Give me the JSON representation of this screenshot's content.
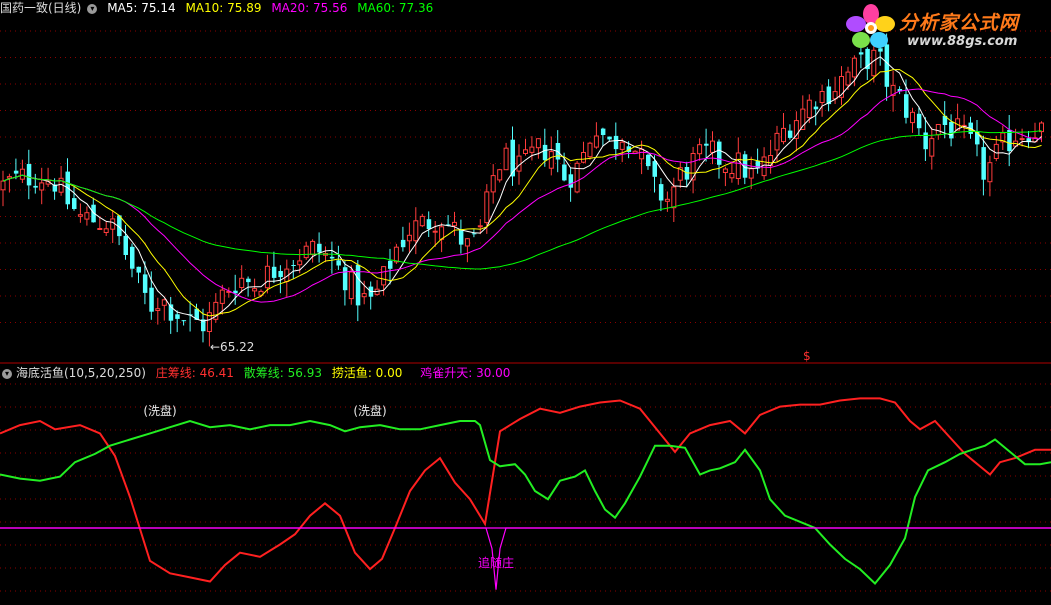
{
  "main_header": {
    "title": "国药一致(日线)",
    "ma5": "MA5: 75.14",
    "ma10": "MA10: 75.89",
    "ma20": "MA20: 75.56",
    "ma60": "MA60: 77.36"
  },
  "sub_header": {
    "title": "海底活鱼(10,5,20,250)",
    "zhuang": "庄筹线: 46.41",
    "san": "散筹线: 56.93",
    "lao": "捞活鱼: 0.00",
    "que": "鸡雀升天: 30.00"
  },
  "logo": {
    "title": "分析家公式网",
    "url": "www.88gs.com"
  },
  "colors": {
    "up": "#ff3c3c",
    "down": "#54ffff",
    "ma5": "#ffffff",
    "ma10": "#ffff00",
    "ma20": "#ff00ff",
    "ma60": "#00ff00",
    "zhuang": "#ff2020",
    "san": "#22ee22",
    "que": "#ff00ff",
    "grid": "#8b0000"
  },
  "chart_data": [
    {
      "type": "candlestick",
      "title": "国药一致(日线)",
      "low_label": "65.22",
      "marker": "$",
      "ylim": [
        63,
        86
      ],
      "ma_series": [
        "MA5",
        "MA10",
        "MA20",
        "MA60"
      ],
      "ma_values": {
        "MA5": 75.14,
        "MA10": 75.89,
        "MA20": 75.56,
        "MA60": 77.36
      },
      "close_profile": [
        [
          0,
          74.6
        ],
        [
          10,
          75.0
        ],
        [
          25,
          75.3
        ],
        [
          40,
          75.4
        ],
        [
          55,
          75.0
        ],
        [
          65,
          73.8
        ],
        [
          80,
          72.6
        ],
        [
          95,
          72.4
        ],
        [
          110,
          72.2
        ],
        [
          120,
          71.0
        ],
        [
          130,
          69.5
        ],
        [
          140,
          67.8
        ],
        [
          150,
          66.6
        ],
        [
          160,
          67.2
        ],
        [
          170,
          66.5
        ],
        [
          180,
          66.0
        ],
        [
          190,
          65.6
        ],
        [
          205,
          65.4
        ],
        [
          215,
          66.4
        ],
        [
          225,
          67.7
        ],
        [
          240,
          68.5
        ],
        [
          255,
          68.1
        ],
        [
          270,
          68.9
        ],
        [
          285,
          69.6
        ],
        [
          300,
          70.1
        ],
        [
          315,
          70.5
        ],
        [
          330,
          69.8
        ],
        [
          345,
          68.6
        ],
        [
          360,
          67.1
        ],
        [
          372,
          66.9
        ],
        [
          382,
          68.2
        ],
        [
          395,
          70.4
        ],
        [
          410,
          71.8
        ],
        [
          425,
          72.2
        ],
        [
          440,
          72.7
        ],
        [
          455,
          71.6
        ],
        [
          470,
          70.4
        ],
        [
          482,
          71.9
        ],
        [
          495,
          75.9
        ],
        [
          505,
          76.6
        ],
        [
          520,
          75.7
        ],
        [
          535,
          77.0
        ],
        [
          550,
          77.3
        ],
        [
          565,
          75.2
        ],
        [
          580,
          76.1
        ],
        [
          595,
          79.0
        ],
        [
          610,
          77.4
        ],
        [
          625,
          78.4
        ],
        [
          640,
          76.6
        ],
        [
          655,
          74.4
        ],
        [
          668,
          73.8
        ],
        [
          680,
          75.4
        ],
        [
          695,
          76.4
        ],
        [
          710,
          76.9
        ],
        [
          725,
          76.3
        ],
        [
          740,
          76.1
        ],
        [
          755,
          75.2
        ],
        [
          770,
          76.8
        ],
        [
          785,
          78.6
        ],
        [
          800,
          79.6
        ],
        [
          815,
          80.7
        ],
        [
          830,
          81.1
        ],
        [
          845,
          82.1
        ],
        [
          860,
          82.9
        ],
        [
          870,
          83.4
        ],
        [
          880,
          83.0
        ],
        [
          890,
          81.2
        ],
        [
          900,
          80.5
        ],
        [
          912,
          79.3
        ],
        [
          925,
          77.6
        ],
        [
          940,
          79.0
        ],
        [
          955,
          78.4
        ],
        [
          970,
          77.5
        ],
        [
          985,
          75.5
        ],
        [
          1000,
          77.1
        ],
        [
          1015,
          78.2
        ],
        [
          1030,
          78.5
        ],
        [
          1051,
          78.6
        ]
      ]
    },
    {
      "type": "line",
      "title": "海底活鱼(10,5,20,250)",
      "ylim": [
        -5,
        100
      ],
      "series": [
        {
          "name": "庄筹线",
          "values": [
            [
              0,
              76
            ],
            [
              20,
              80
            ],
            [
              40,
              82
            ],
            [
              55,
              78
            ],
            [
              80,
              80
            ],
            [
              100,
              76
            ],
            [
              115,
              65
            ],
            [
              130,
              45
            ],
            [
              150,
              14
            ],
            [
              170,
              8
            ],
            [
              190,
              6
            ],
            [
              210,
              4
            ],
            [
              225,
              12
            ],
            [
              240,
              18
            ],
            [
              260,
              16
            ],
            [
              280,
              22
            ],
            [
              295,
              27
            ],
            [
              310,
              36
            ],
            [
              325,
              42
            ],
            [
              340,
              36
            ],
            [
              355,
              18
            ],
            [
              370,
              10
            ],
            [
              382,
              15
            ],
            [
              395,
              30
            ],
            [
              410,
              48
            ],
            [
              425,
              58
            ],
            [
              440,
              64
            ],
            [
              455,
              52
            ],
            [
              470,
              44
            ],
            [
              485,
              32
            ],
            [
              500,
              77
            ],
            [
              520,
              83
            ],
            [
              540,
              88
            ],
            [
              560,
              86
            ],
            [
              580,
              89
            ],
            [
              600,
              91
            ],
            [
              620,
              92
            ],
            [
              640,
              88
            ],
            [
              660,
              76
            ],
            [
              675,
              67
            ],
            [
              690,
              76
            ],
            [
              710,
              80
            ],
            [
              730,
              82
            ],
            [
              745,
              76
            ],
            [
              760,
              85
            ],
            [
              780,
              89
            ],
            [
              800,
              90
            ],
            [
              820,
              90
            ],
            [
              840,
              92
            ],
            [
              860,
              93
            ],
            [
              880,
              93
            ],
            [
              895,
              91
            ],
            [
              910,
              82
            ],
            [
              920,
              78
            ],
            [
              935,
              82
            ],
            [
              950,
              74
            ],
            [
              965,
              66
            ],
            [
              975,
              62
            ],
            [
              990,
              56
            ],
            [
              1000,
              62
            ],
            [
              1015,
              64
            ],
            [
              1035,
              68
            ],
            [
              1051,
              68
            ]
          ]
        },
        {
          "name": "散筹线",
          "values": [
            [
              0,
              56
            ],
            [
              20,
              54
            ],
            [
              40,
              53
            ],
            [
              60,
              55
            ],
            [
              75,
              62
            ],
            [
              95,
              66
            ],
            [
              110,
              70
            ],
            [
              130,
              73
            ],
            [
              150,
              76
            ],
            [
              170,
              79
            ],
            [
              190,
              82
            ],
            [
              210,
              79
            ],
            [
              230,
              80
            ],
            [
              250,
              78
            ],
            [
              270,
              80
            ],
            [
              290,
              80
            ],
            [
              310,
              82
            ],
            [
              330,
              80
            ],
            [
              345,
              77
            ],
            [
              360,
              79
            ],
            [
              380,
              80
            ],
            [
              400,
              78
            ],
            [
              420,
              78
            ],
            [
              440,
              80
            ],
            [
              460,
              82
            ],
            [
              475,
              82
            ],
            [
              480,
              80
            ],
            [
              490,
              63
            ],
            [
              500,
              60
            ],
            [
              515,
              61
            ],
            [
              525,
              56
            ],
            [
              535,
              48
            ],
            [
              548,
              44
            ],
            [
              560,
              53
            ],
            [
              575,
              55
            ],
            [
              585,
              58
            ],
            [
              595,
              48
            ],
            [
              605,
              39
            ],
            [
              615,
              35
            ],
            [
              625,
              42
            ],
            [
              640,
              55
            ],
            [
              655,
              70
            ],
            [
              670,
              70
            ],
            [
              685,
              69
            ],
            [
              700,
              56
            ],
            [
              710,
              58
            ],
            [
              720,
              59
            ],
            [
              735,
              62
            ],
            [
              745,
              68
            ],
            [
              760,
              58
            ],
            [
              770,
              44
            ],
            [
              785,
              36
            ],
            [
              800,
              33
            ],
            [
              815,
              30
            ],
            [
              830,
              22
            ],
            [
              845,
              15
            ],
            [
              860,
              10
            ],
            [
              875,
              3
            ],
            [
              890,
              12
            ],
            [
              905,
              25
            ],
            [
              915,
              45
            ],
            [
              928,
              58
            ],
            [
              945,
              62
            ],
            [
              960,
              66
            ],
            [
              972,
              68
            ],
            [
              985,
              70
            ],
            [
              995,
              73
            ],
            [
              1010,
              67
            ],
            [
              1025,
              61
            ],
            [
              1040,
              61
            ],
            [
              1051,
              62
            ]
          ]
        },
        {
          "name": "鸡雀升天",
          "values": [
            [
              0,
              30
            ],
            [
              1051,
              30
            ]
          ]
        },
        {
          "name": "捞活鱼",
          "values": [
            [
              0,
              30
            ],
            [
              486,
              30
            ],
            [
              492,
              20
            ],
            [
              496,
              0
            ],
            [
              500,
              20
            ],
            [
              506,
              30
            ],
            [
              1051,
              30
            ]
          ]
        }
      ],
      "annotations": [
        {
          "text": "(洗盘)",
          "x": 160
        },
        {
          "text": "(洗盘)",
          "x": 370
        },
        {
          "text": "追随庄",
          "x": 496
        }
      ]
    }
  ]
}
